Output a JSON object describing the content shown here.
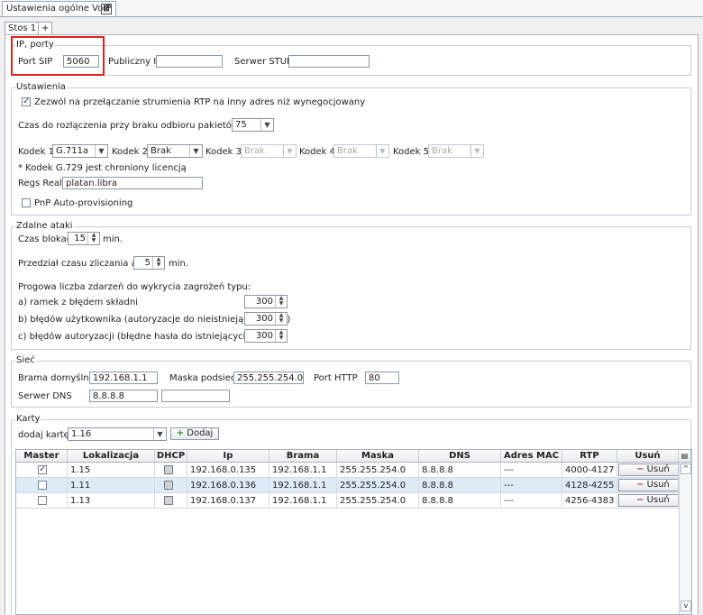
{
  "window": {
    "tab_title": "Ustawienia ogólne VoIP",
    "close_symbol": "⊠"
  },
  "subtabs": [
    {
      "label": "Stos 1"
    },
    {
      "label": "+"
    }
  ],
  "ip_ports": {
    "legend": "IP, porty",
    "port_sip_label": "Port SIP",
    "port_sip_value": "5060",
    "public_ip_label": "Publiczny IP",
    "public_ip_value": "",
    "stun_label": "Serwer STUN",
    "stun_value": ""
  },
  "settings": {
    "legend": "Ustawienia",
    "rtp_switch_label": "Zezwól na przełączanie strumienia RTP na inny adres niż wynegocjowany",
    "rtp_switch_checked": true,
    "disconnect_label": "Czas do rozłączenia przy braku odbioru pakietów RTP [s]",
    "disconnect_value": "75",
    "codec1_label": "Kodek 1",
    "codec1_value": "G.711a",
    "codec2_label": "Kodek 2",
    "codec2_value": "Brak",
    "codec3_label": "Kodek 3",
    "codec3_value": "Brak",
    "codec4_label": "Kodek 4",
    "codec4_value": "Brak",
    "codec5_label": "Kodek 5",
    "codec5_value": "Brak",
    "codec_note": "* Kodek G.729 jest chroniony licencją",
    "realm_label": "Regs Realm",
    "realm_value": "platan.libra",
    "pnp_label": "PnP Auto-provisioning",
    "pnp_checked": false
  },
  "attacks": {
    "legend": "Zdalne ataki",
    "block_label": "Czas blokady",
    "block_value": "15",
    "block_unit": "min.",
    "interval_label": "Przedział czasu zliczania ataków",
    "interval_value": "5",
    "interval_unit": "min.",
    "threshold_label": "Progowa liczba zdarzeń do wykrycia zagrożeń typu:",
    "a_label": "a) ramek z błędem składni",
    "a_value": "300",
    "b_label": "b) błędów użytkownika (autoryzacje do nieistniejących kont)",
    "b_value": "300",
    "c_label": "c) błędów autoryzacji (błędne hasła do istniejących kont)",
    "c_value": "300"
  },
  "network": {
    "legend": "Sieć",
    "gateway_label": "Brama domyślna",
    "gateway_value": "192.168.1.1",
    "mask_label": "Maska podsieci",
    "mask_value": "255.255.254.0",
    "http_label": "Port HTTP",
    "http_value": "80",
    "dns_label": "Serwer DNS",
    "dns_value": "8.8.8.8",
    "dns2_value": ""
  },
  "cards": {
    "legend": "Karty",
    "add_label": "dodaj kartę:",
    "add_value": "1.16",
    "add_button": "Dodaj",
    "columns": [
      "Master",
      "Lokalizacja",
      "DHCP",
      "Ip",
      "Brama",
      "Maska",
      "DNS",
      "Adres MAC",
      "RTP",
      "Usuń"
    ],
    "rows": [
      {
        "master": true,
        "loc": "1.15",
        "ip": "192.168.0.135",
        "gw": "192.168.1.1",
        "mask": "255.255.254.0",
        "dns": "8.8.8.8",
        "mac": "---",
        "rtp": "4000-4127",
        "remove": "Usuń"
      },
      {
        "master": false,
        "loc": "1.11",
        "ip": "192.168.0.136",
        "gw": "192.168.1.1",
        "mask": "255.255.254.0",
        "dns": "8.8.8.8",
        "mac": "---",
        "rtp": "4128-4255",
        "remove": "Usuń"
      },
      {
        "master": false,
        "loc": "1.13",
        "ip": "192.168.0.137",
        "gw": "192.168.1.1",
        "mask": "255.255.254.0",
        "dns": "8.8.8.8",
        "mac": "---",
        "rtp": "4256-4383",
        "remove": "Usuń"
      }
    ]
  }
}
